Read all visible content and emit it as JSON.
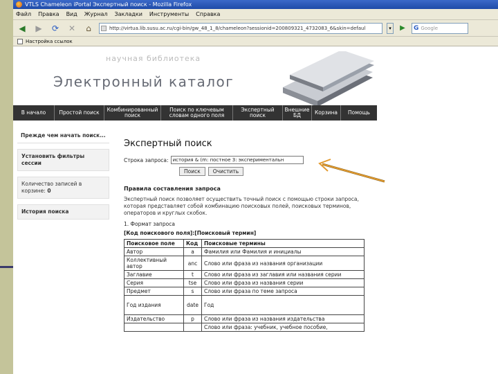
{
  "window": {
    "title": "VTLS Chameleon iPortal Экспертный поиск - Mozilla Firefox"
  },
  "menu": [
    "Файл",
    "Правка",
    "Вид",
    "Журнал",
    "Закладки",
    "Инструменты",
    "Справка"
  ],
  "navbar": {
    "url": "http://virtua.lib.susu.ac.ru/cgi-bin/gw_48_1_8/chameleon?sessionid=200809321_4732083_6&skin=defaul",
    "search_placeholder": "Google"
  },
  "bookmarks": {
    "item": "Настройка ссылок"
  },
  "header": {
    "subtitle": "научная библиотека",
    "title": "Электронный каталог"
  },
  "main_nav": [
    "В начало",
    "Простой поиск",
    "Комбинированный поиск",
    "Поиск по ключевым словам одного поля",
    "Экспертный поиск",
    "Внешние БД",
    "Корзина",
    "Помощь"
  ],
  "sidebar": {
    "before_search": "Прежде чем начать поиск...",
    "set_filters": "Установить фильтры сессии",
    "records_label": "Количество записей в корзине:",
    "records_count": "0",
    "search_history": "История поиска"
  },
  "search": {
    "page_title": "Экспертный поиск",
    "query_label": "Строка запроса:",
    "query_value": "история & (m: постное 3: экспериментальн",
    "search_button": "Поиск",
    "clear_button": "Очистить"
  },
  "rules": {
    "title": "Правила составления запроса",
    "paragraph": "Экспертный поиск позволяет осуществить точный поиск с помощью строки запроса, которая представляет собой комбинацию поисковых полей, поисковых терминов, операторов и круглых скобок.",
    "format_label": "1. Формат запроса",
    "format_value": "[Код поискового поля]:[Поисковый термин]"
  },
  "table": {
    "headers": [
      "Поисковое поле",
      "Код",
      "Поисковые термины"
    ],
    "rows": [
      [
        "Автор",
        "a",
        "Фамилия или Фамилия и инициалы"
      ],
      [
        "Коллективный автор",
        "anc",
        "Слово или фраза из названия организации"
      ],
      [
        "Заглавие",
        "t",
        "Слово или фраза из заглавия или названия серии"
      ],
      [
        "Серия",
        "tse",
        "Слово или фраза из названия серии"
      ],
      [
        "Предмет",
        "s",
        "Слово или фраза по теме запроса"
      ],
      [
        "Год издания",
        "date",
        "Год"
      ],
      [
        "Издательство",
        "p",
        "Слово или фраза из названия издательства"
      ],
      [
        "",
        "",
        "Слово или фраза: учебник, учебное пособие,"
      ]
    ]
  },
  "colors": {
    "nav_bar": "#333333",
    "annotation_arrow": "#e39a2e",
    "olive_margin": "#c4c49a"
  }
}
